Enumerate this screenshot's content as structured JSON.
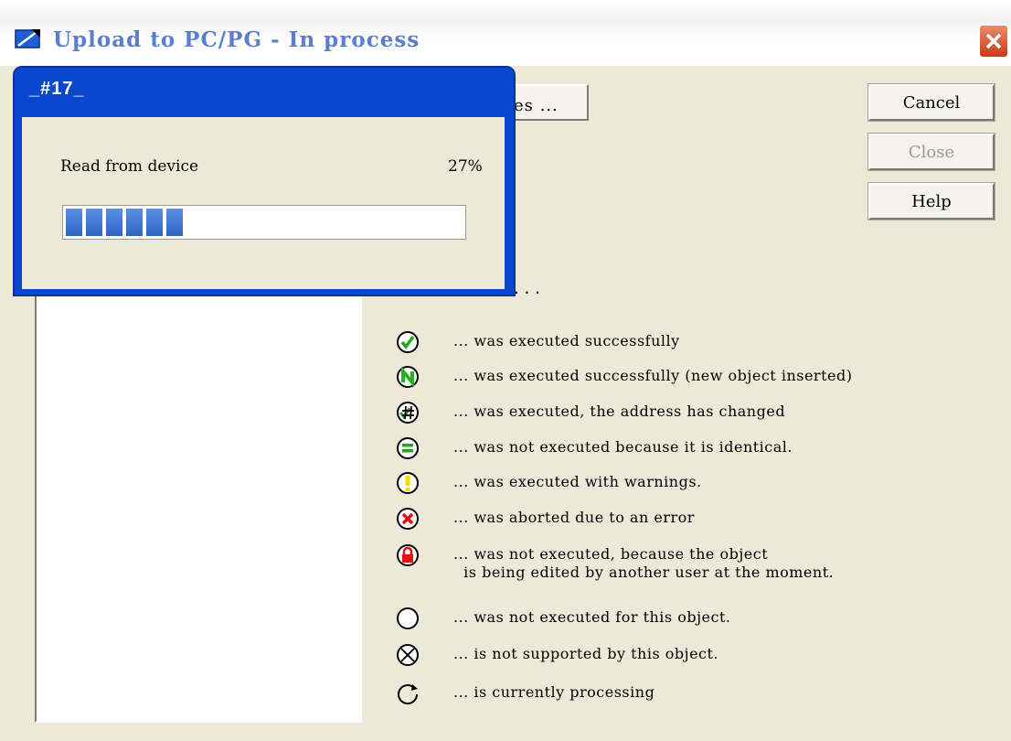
{
  "window": {
    "title": "Upload to PC/PG - In process"
  },
  "buttons": {
    "details_partial": "es ...",
    "cancel": "Cancel",
    "close": "Close",
    "help": "Help"
  },
  "ellipsis": "...",
  "legend": [
    {
      "icon": "check-green-icon",
      "text": "... was executed successfully"
    },
    {
      "icon": "new-object-green-icon",
      "text": "... was executed successfully (new object inserted)"
    },
    {
      "icon": "address-changed-icon",
      "text": "... was executed, the address has changed"
    },
    {
      "icon": "identical-green-icon",
      "text": "... was not executed because it is identical."
    },
    {
      "icon": "warning-yellow-icon",
      "text": "... was executed with warnings."
    },
    {
      "icon": "error-red-icon",
      "text": "... was aborted due to an error"
    },
    {
      "icon": "lock-red-icon",
      "text": "... was not executed, because the object\n  is being edited by another user at the moment."
    },
    {
      "icon": "not-executed-circle-icon",
      "text": "... was not executed for this object."
    },
    {
      "icon": "not-supported-icon",
      "text": "... is not supported by this object."
    },
    {
      "icon": "processing-icon",
      "text": "... is currently processing"
    }
  ],
  "progress_popup": {
    "title": "_#17_",
    "label": "Read from device",
    "percent_text": "27%",
    "progress": 0.27
  },
  "colors": {
    "titlebar_blue": "#0a47cf",
    "progress_blue": "#2f63c4",
    "dialog_bg": "#ece9d8"
  }
}
